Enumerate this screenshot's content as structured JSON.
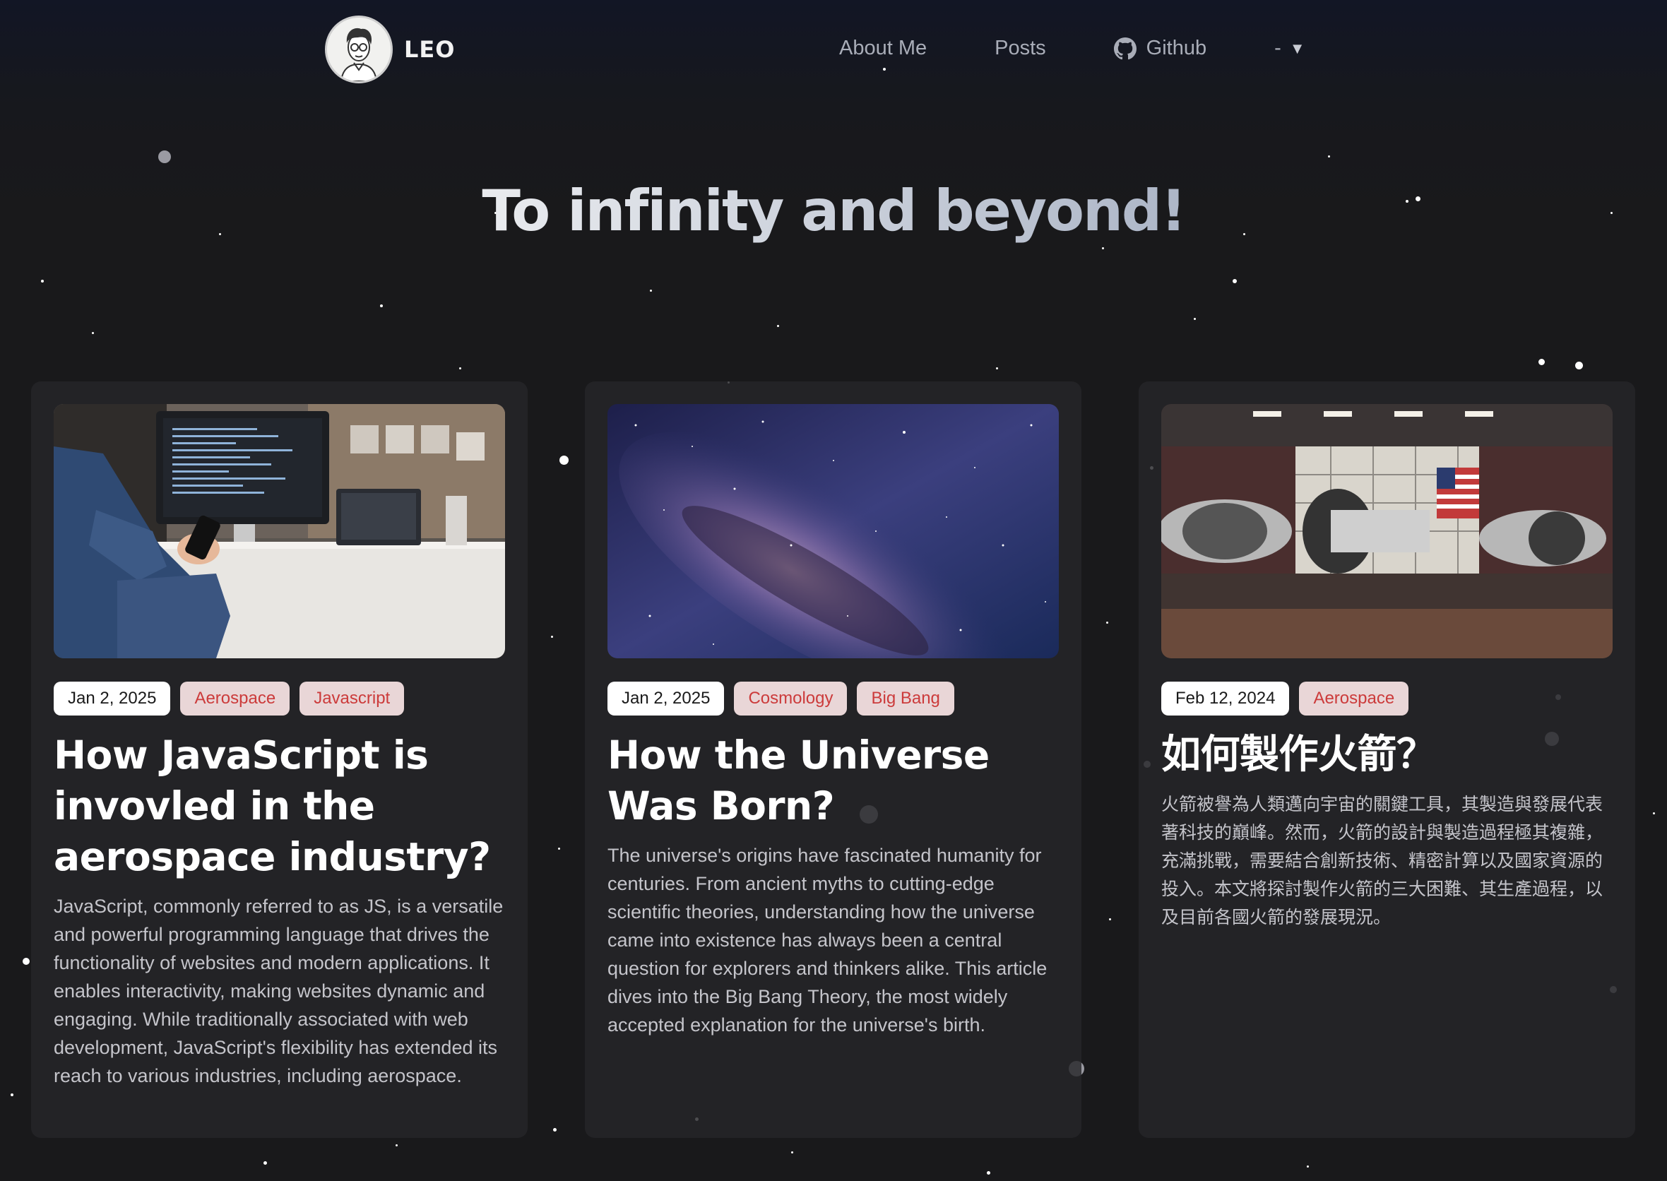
{
  "header": {
    "brand_name": "LEO",
    "nav": {
      "about": "About Me",
      "posts": "Posts",
      "github": "Github",
      "language": "-"
    }
  },
  "hero": {
    "title": "To infinity and beyond!"
  },
  "posts": [
    {
      "date": "Jan 2, 2025",
      "tags": [
        "Aerospace",
        "Javascript"
      ],
      "title": "How JavaScript is invovled in the aerospace industry?",
      "excerpt": "JavaScript, commonly referred to as JS, is a versatile and powerful programming language that drives the functionality of websites and modern applications. It enables interactivity, making websites dynamic and engaging. While traditionally associated with web development, JavaScript's flexibility has extended its reach to various industries, including aerospace."
    },
    {
      "date": "Jan 2, 2025",
      "tags": [
        "Cosmology",
        "Big Bang"
      ],
      "title": "How the Universe Was Born?",
      "excerpt": "The universe's origins have fascinated humanity for centuries. From ancient myths to cutting-edge scientific theories, understanding how the universe came into existence has always been a central question for explorers and thinkers alike. This article dives into the Big Bang Theory, the most widely accepted explanation for the universe's birth."
    },
    {
      "date": "Feb 12, 2024",
      "tags": [
        "Aerospace"
      ],
      "title": "如何製作火箭？",
      "excerpt": "火箭被譽為人類邁向宇宙的關鍵工具，其製造與發展代表著科技的巔峰。然而，火箭的設計與製造過程極其複雜，充滿挑戰，需要結合創新技術、精密計算以及國家資源的投入。本文將探討製作火箭的三大困難、其生產過程，以及目前各國火箭的發展現況。"
    }
  ]
}
